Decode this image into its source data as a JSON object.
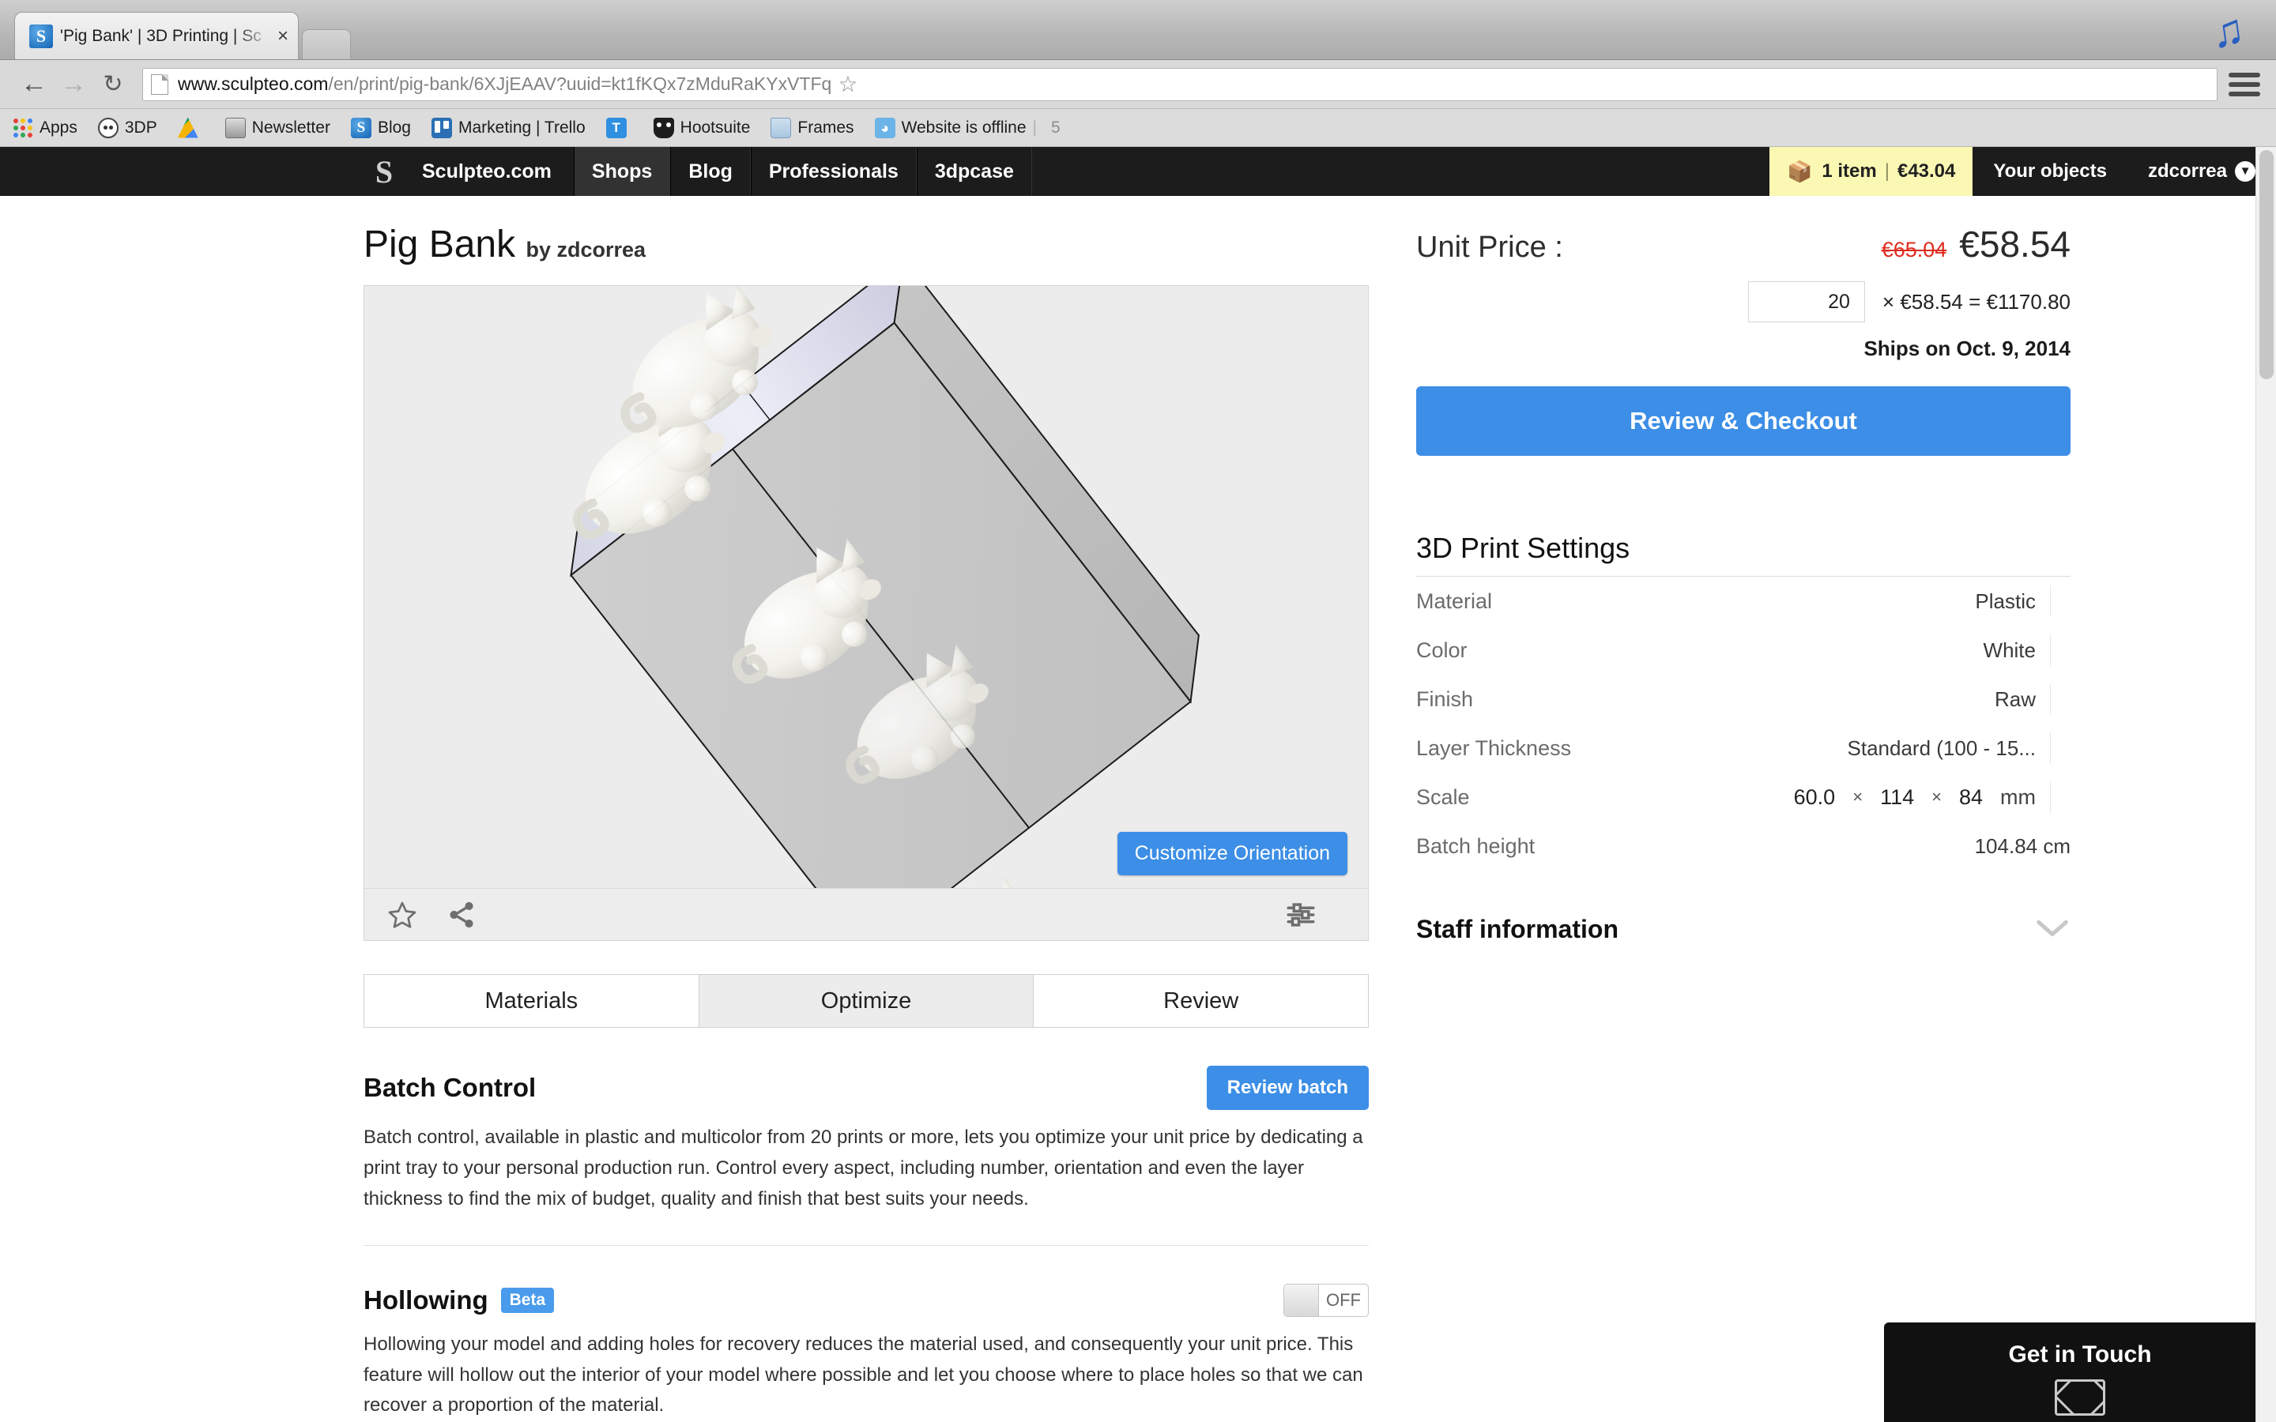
{
  "browser": {
    "tab_title": "'Pig Bank' | 3D Printing | Sc",
    "tab_close": "×",
    "back_icon": "←",
    "forward_icon": "→",
    "reload_icon": "↻",
    "url_domain": "www.sculpteo.com",
    "url_path": "/en/print/pig-bank/6XJjEAAV?uuid=kt1fKQx7zMduRaKYxVTFq",
    "star_icon": "☆",
    "bookmarks": [
      {
        "label": "Apps",
        "icon": "apps-grid-icon"
      },
      {
        "label": "3DP",
        "icon": "reddit-icon"
      },
      {
        "label": "",
        "icon": "google-drive-icon"
      },
      {
        "label": "Newsletter",
        "icon": "newsletter-icon"
      },
      {
        "label": "Blog",
        "icon": "sculpteo-icon"
      },
      {
        "label": "Marketing | Trello",
        "icon": "trello-icon"
      },
      {
        "label": "",
        "icon": "tumblr-icon"
      },
      {
        "label": "Hootsuite",
        "icon": "owl-icon"
      },
      {
        "label": "Frames",
        "icon": "folder-icon"
      },
      {
        "label": "Website is offline",
        "icon": "rss-icon"
      }
    ],
    "bookmarks_overflow": "5"
  },
  "sitenav": {
    "logo": "S",
    "items": [
      {
        "label": "Sculpteo.com",
        "active": false
      },
      {
        "label": "Shops",
        "active": true
      },
      {
        "label": "Blog",
        "active": false
      },
      {
        "label": "Professionals",
        "active": false
      },
      {
        "label": "3dpcase",
        "active": false
      }
    ],
    "cart_icon": "🧺",
    "cart_items": "1 item",
    "cart_divider": "|",
    "cart_total": "€43.04",
    "your_objects": "Your objects",
    "username": "zdcorrea",
    "user_caret": "▼"
  },
  "product": {
    "title": "Pig Bank",
    "by": "by zdcorrea"
  },
  "viewer": {
    "customize_button": "Customize Orientation",
    "favorite_icon": "star-outline-icon",
    "share_icon": "share-icon",
    "settings_icon": "sliders-icon"
  },
  "tabs": [
    {
      "label": "Materials",
      "active": false
    },
    {
      "label": "Optimize",
      "active": true
    },
    {
      "label": "Review",
      "active": false
    }
  ],
  "batch": {
    "heading": "Batch Control",
    "button": "Review batch",
    "text": "Batch control, available in plastic and multicolor from 20 prints or more, lets you optimize your unit price by dedicating a print tray to your personal production run. Control every aspect, including number, orientation and even the layer thickness to find the mix of budget, quality and finish that best suits your needs."
  },
  "hollowing": {
    "heading": "Hollowing",
    "badge": "Beta",
    "toggle_state": "OFF",
    "text": "Hollowing your model and adding holes for recovery reduces the material used, and consequently your unit price. This feature will hollow out the interior of your model where possible and let you choose where to place holes so that we can recover a proportion of the material."
  },
  "pricing": {
    "label": "Unit Price :",
    "old_price": "€65.04",
    "new_price": "€58.54",
    "quantity": "20",
    "expression": "× €58.54 = €1170.80",
    "ships": "Ships on Oct. 9, 2014",
    "checkout_button": "Review & Checkout"
  },
  "print_settings": {
    "title": "3D Print Settings",
    "rows": [
      {
        "key": "Material",
        "value": "Plastic"
      },
      {
        "key": "Color",
        "value": "White"
      },
      {
        "key": "Finish",
        "value": "Raw"
      },
      {
        "key": "Layer Thickness",
        "value": "Standard (100 - 15..."
      }
    ],
    "scale_key": "Scale",
    "scale_x": "60.0",
    "scale_y": "114",
    "scale_z": "84",
    "scale_mult": "×",
    "scale_unit": "mm",
    "batch_height_key": "Batch height",
    "batch_height_value": "104.84 cm"
  },
  "staff": {
    "title": "Staff information",
    "chevron": "∨"
  },
  "get_in_touch": {
    "title": "Get in Touch",
    "icon": "envelope-icon"
  }
}
